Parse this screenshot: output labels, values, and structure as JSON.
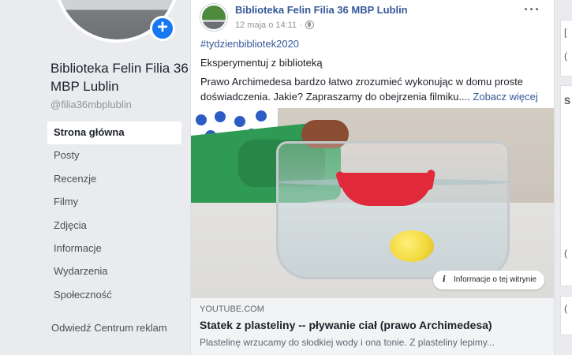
{
  "profile": {
    "name": "Biblioteka Felin Filia 36 MBP Lublin",
    "handle": "@filia36mbplublin",
    "add_icon": "plus-icon"
  },
  "nav": {
    "items": [
      {
        "label": "Strona główna",
        "active": true
      },
      {
        "label": "Posty"
      },
      {
        "label": "Recenzje"
      },
      {
        "label": "Filmy"
      },
      {
        "label": "Zdjęcia"
      },
      {
        "label": "Informacje"
      },
      {
        "label": "Wydarzenia"
      },
      {
        "label": "Społeczność"
      }
    ],
    "ad_center": "Odwiedź Centrum reklam"
  },
  "post": {
    "author": "Biblioteka Felin Filia 36 MBP Lublin",
    "time": "12 maja o 14:11 ·",
    "more": "···",
    "hashtag": "#tydzienbibliotek2020",
    "line1": "Eksperymentuj z biblioteką",
    "body": "Prawo Archimedesa bardzo łatwo zrozumieć wykonując w domu proste doświadczenia. Jakie? Zapraszamy do obejrzenia filmiku....",
    "see_more": "Zobacz więcej",
    "info_pill": "Informacje o tej witrynie",
    "link": {
      "source": "YOUTUBE.COM",
      "title": "Statek z plasteliny -- pływanie ciał (prawo Archimedesa)",
      "description": "Plastelinę wrzucamy do słodkiej wody i ona tonie. Z plasteliny lepimy..."
    }
  },
  "colors": {
    "link_blue": "#365899",
    "accent": "#1877f2",
    "background": "#e9ebee"
  }
}
